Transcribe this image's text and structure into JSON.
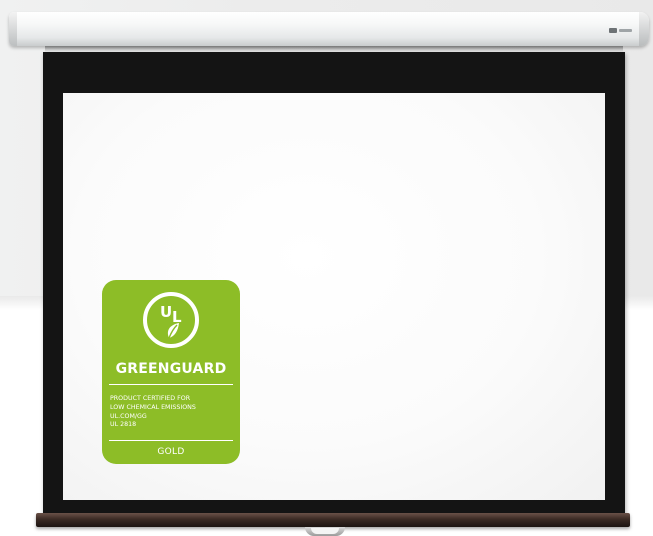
{
  "badge": {
    "emblem_letters": [
      "U",
      "L"
    ],
    "name": "GREENGUARD",
    "lines": [
      "PRODUCT CERTIFIED FOR",
      "LOW CHEMICAL EMISSIONS",
      "UL.COM/GG",
      "UL 2818"
    ],
    "level": "GOLD",
    "color": "#8dbd27",
    "emblem_icon": "ul-leaf-icon"
  },
  "screen": {
    "case_color": "#f2f3f3",
    "border_color": "#141414",
    "surface_color": "#fbfbfb",
    "bottom_bar_color": "#3b2a24",
    "logo_icon": "brand-logo-icon"
  }
}
